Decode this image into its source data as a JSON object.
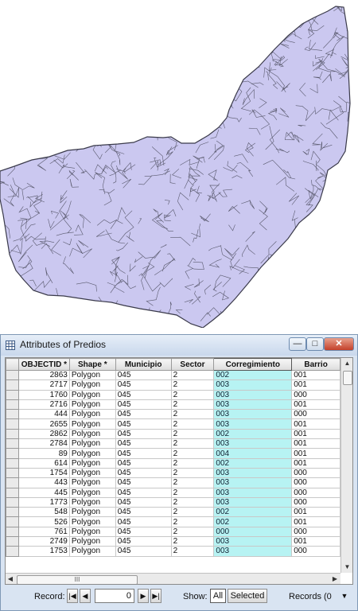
{
  "window": {
    "title": "Attributes of Predios",
    "min_label": "—",
    "max_label": "□",
    "close_label": "✕"
  },
  "table": {
    "columns": [
      "OBJECTID *",
      "Shape *",
      "Municipio",
      "Sector",
      "Corregimiento",
      "Barrio"
    ],
    "rows": [
      [
        "2863",
        "Polygon",
        "045",
        "2",
        "002",
        "001"
      ],
      [
        "2717",
        "Polygon",
        "045",
        "2",
        "003",
        "001"
      ],
      [
        "1760",
        "Polygon",
        "045",
        "2",
        "003",
        "000"
      ],
      [
        "2716",
        "Polygon",
        "045",
        "2",
        "003",
        "001"
      ],
      [
        "444",
        "Polygon",
        "045",
        "2",
        "003",
        "000"
      ],
      [
        "2655",
        "Polygon",
        "045",
        "2",
        "003",
        "001"
      ],
      [
        "2862",
        "Polygon",
        "045",
        "2",
        "002",
        "001"
      ],
      [
        "2784",
        "Polygon",
        "045",
        "2",
        "003",
        "001"
      ],
      [
        "89",
        "Polygon",
        "045",
        "2",
        "004",
        "001"
      ],
      [
        "614",
        "Polygon",
        "045",
        "2",
        "002",
        "001"
      ],
      [
        "1754",
        "Polygon",
        "045",
        "2",
        "003",
        "000"
      ],
      [
        "443",
        "Polygon",
        "045",
        "2",
        "003",
        "000"
      ],
      [
        "445",
        "Polygon",
        "045",
        "2",
        "003",
        "000"
      ],
      [
        "1773",
        "Polygon",
        "045",
        "2",
        "003",
        "000"
      ],
      [
        "548",
        "Polygon",
        "045",
        "2",
        "002",
        "001"
      ],
      [
        "526",
        "Polygon",
        "045",
        "2",
        "002",
        "001"
      ],
      [
        "761",
        "Polygon",
        "045",
        "2",
        "000",
        "000"
      ],
      [
        "2749",
        "Polygon",
        "045",
        "2",
        "003",
        "001"
      ],
      [
        "1753",
        "Polygon",
        "045",
        "2",
        "003",
        "000"
      ]
    ],
    "highlight_color": "#b7f3f3",
    "hscroll_label": "III"
  },
  "footer": {
    "record_label": "Record:",
    "record_value": "0",
    "show_label": "Show:",
    "all_label": "All",
    "selected_label": "Selected",
    "records_label": "Records (0"
  },
  "map": {
    "fill": "#cbc8f0",
    "stroke": "#4a4a5a"
  }
}
